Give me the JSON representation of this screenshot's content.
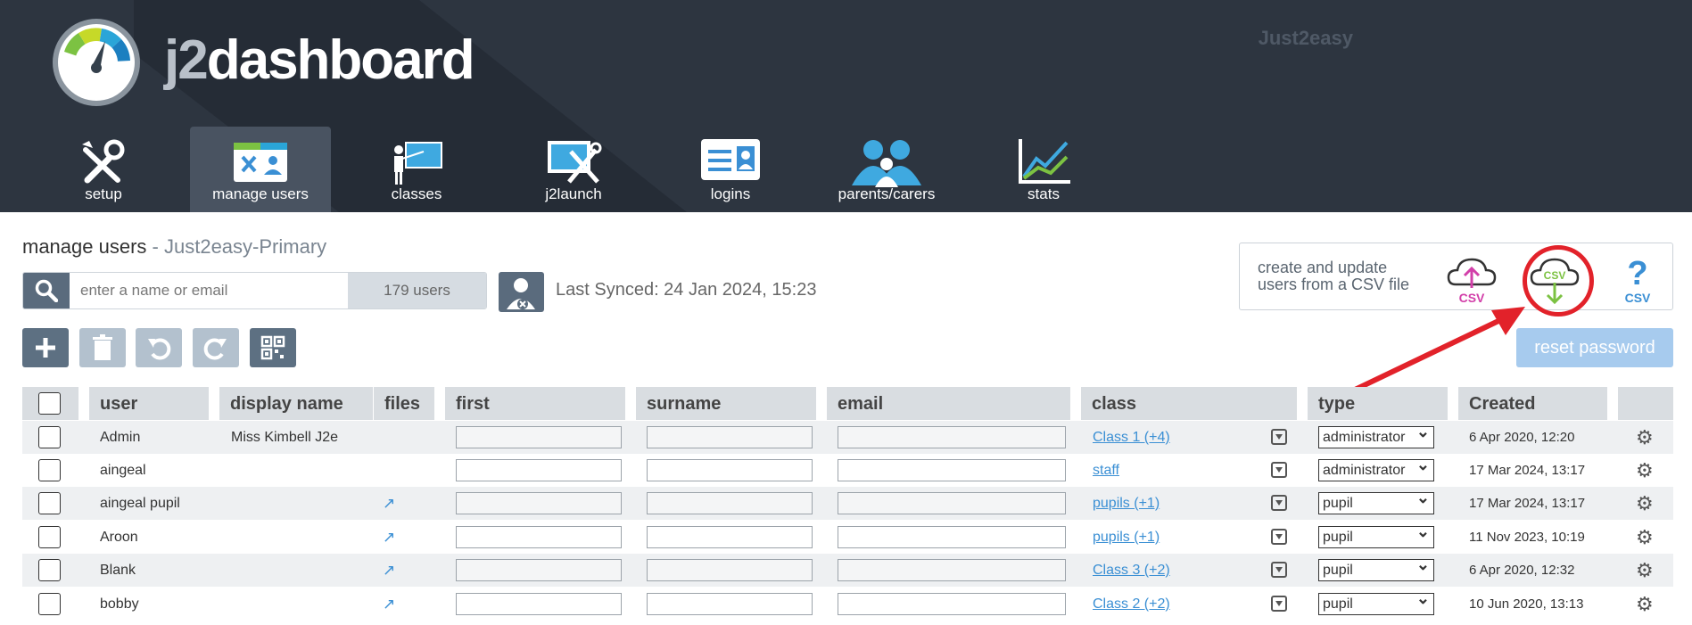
{
  "header": {
    "logo_j2": "j2",
    "logo_rest": "dashboard",
    "brand": "Just2easy"
  },
  "nav": [
    {
      "label": "setup",
      "icon": "tools-icon"
    },
    {
      "label": "manage users",
      "icon": "manage-users-icon",
      "active": true
    },
    {
      "label": "classes",
      "icon": "classes-icon"
    },
    {
      "label": "j2launch",
      "icon": "j2launch-icon"
    },
    {
      "label": "logins",
      "icon": "logins-icon"
    },
    {
      "label": "parents/carers",
      "icon": "parents-icon"
    },
    {
      "label": "stats",
      "icon": "stats-icon"
    }
  ],
  "page": {
    "title": "manage users",
    "separator": " - ",
    "school": "Just2easy-Primary"
  },
  "search": {
    "placeholder": "enter a name or email",
    "count": "179 users"
  },
  "sync": {
    "text": "Last Synced: 24 Jan 2024, 15:23"
  },
  "csv": {
    "line1": "create and update",
    "line2": "users from a CSV file",
    "upload_label": "CSV",
    "download_label": "CSV",
    "help_label": "CSV"
  },
  "toolbar": {
    "reset_label": "reset password"
  },
  "table": {
    "headers": {
      "user": "user",
      "display": "display name",
      "files": "files",
      "first": "first",
      "surname": "surname",
      "email": "email",
      "class": "class",
      "type": "type",
      "created": "Created"
    },
    "rows": [
      {
        "user": "Admin",
        "display": "Miss Kimbell J2e",
        "files": "",
        "class": "Class 1 (+4)",
        "type": "administrator",
        "created": "6 Apr 2020, 12:20"
      },
      {
        "user": "aingeal",
        "display": "",
        "files": "",
        "class": "staff",
        "type": "administrator",
        "created": "17 Mar 2024, 13:17"
      },
      {
        "user": "aingeal pupil",
        "display": "",
        "files": "link",
        "class": "pupils (+1)",
        "type": "pupil",
        "created": "17 Mar 2024, 13:17"
      },
      {
        "user": "Aroon",
        "display": "",
        "files": "link",
        "class": "pupils (+1)",
        "type": "pupil",
        "created": "11 Nov 2023, 10:19"
      },
      {
        "user": "Blank",
        "display": "",
        "files": "link",
        "class": "Class 3 (+2)",
        "type": "pupil",
        "created": "6 Apr 2020, 12:32"
      },
      {
        "user": "bobby",
        "display": "",
        "files": "link",
        "class": "Class 2 (+2)",
        "type": "pupil",
        "created": "10 Jun 2020, 13:13"
      }
    ]
  },
  "colors": {
    "header": "#2d3540",
    "accent": "#3a8fd4",
    "highlight": "#e2222a",
    "reset": "#a7cbee"
  }
}
